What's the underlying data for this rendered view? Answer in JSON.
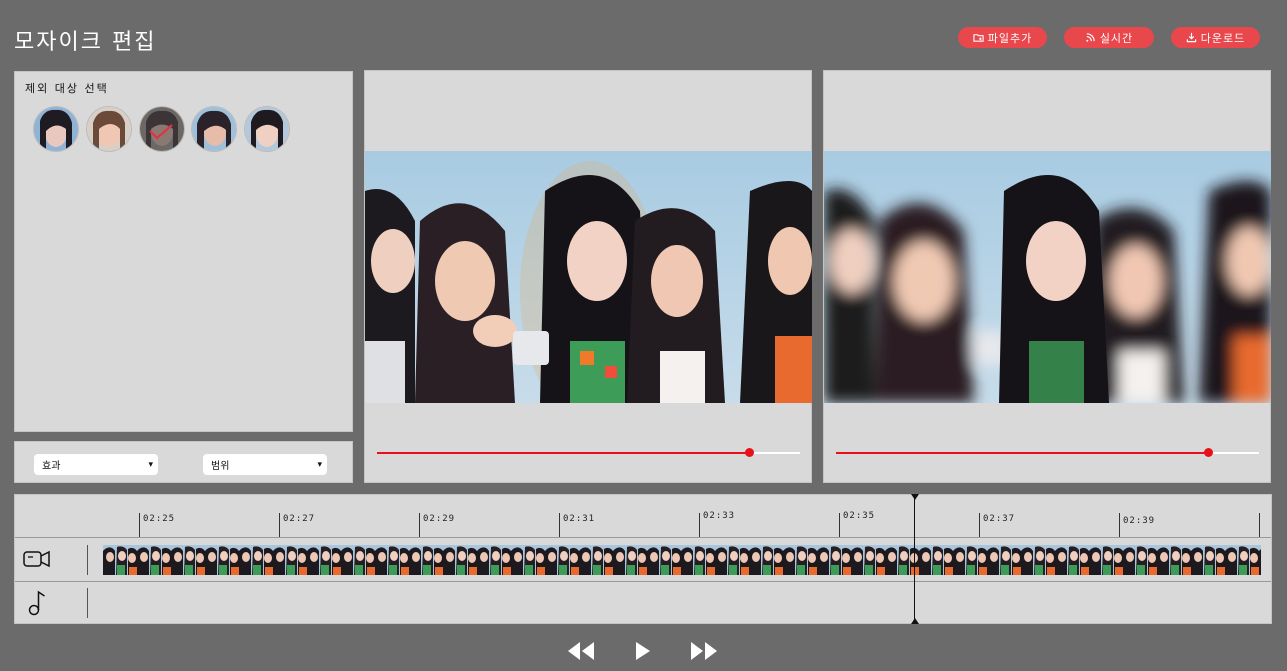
{
  "page": {
    "title": "모자이크 편집"
  },
  "toolbar": {
    "add_file_label": "파일추가",
    "realtime_label": "실시간",
    "download_label": "다운로드",
    "add_file_icon": "folder-plus-icon",
    "realtime_icon": "rss-icon",
    "download_icon": "download-icon",
    "accent_color": "#e8474c"
  },
  "exclusion": {
    "title": "제외 대상 선택",
    "faces": [
      {
        "name": "face-1",
        "selected": false
      },
      {
        "name": "face-2",
        "selected": false
      },
      {
        "name": "face-3",
        "selected": true
      },
      {
        "name": "face-4",
        "selected": false
      },
      {
        "name": "face-5",
        "selected": false
      }
    ]
  },
  "options": {
    "effect_value": "효과",
    "range_value": "범위"
  },
  "original_preview": {
    "progress": 0.88
  },
  "mosaic_preview": {
    "progress": 0.88
  },
  "timeline": {
    "ticks": [
      "02:25",
      "02:27",
      "02:29",
      "02:31",
      "02:33",
      "02:35",
      "02:37",
      "02:39"
    ],
    "playhead_time": "02:35",
    "video_track_icon": "video-camera-icon",
    "audio_track_icon": "music-note-icon"
  },
  "playback": {
    "rewind_icon": "rewind-icon",
    "play_icon": "play-icon",
    "fast_forward_icon": "fast-forward-icon"
  }
}
